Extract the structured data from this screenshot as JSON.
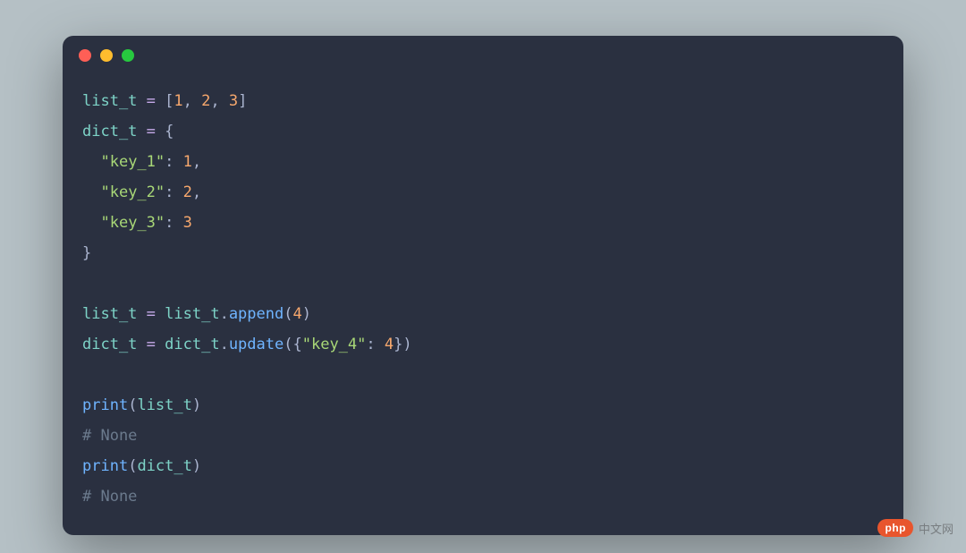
{
  "window": {
    "dots": [
      "red",
      "yellow",
      "green"
    ]
  },
  "code": {
    "var_list": "list_t",
    "var_dict": "dict_t",
    "op_eq": " = ",
    "lbracket": "[",
    "rbracket": "]",
    "lbrace": "{",
    "rbrace": "}",
    "lparen": "(",
    "rparen": ")",
    "comma": ", ",
    "comma_nl": ",",
    "colon": ": ",
    "dot": ".",
    "num1": "1",
    "num2": "2",
    "num3": "3",
    "num4": "4",
    "key1": "\"key_1\"",
    "key2": "\"key_2\"",
    "key3": "\"key_3\"",
    "key4": "\"key_4\"",
    "fn_append": "append",
    "fn_update": "update",
    "fn_print": "print",
    "indent": "  ",
    "comment_none1": "# None",
    "comment_none2": "# None"
  },
  "logo": {
    "badge": "php",
    "text": "中文网"
  }
}
